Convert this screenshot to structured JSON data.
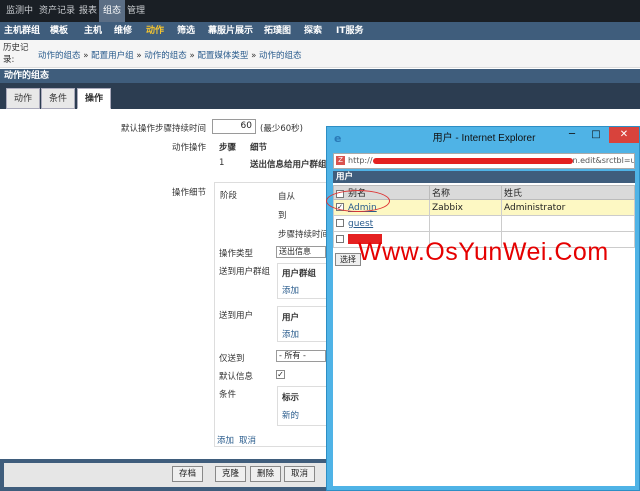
{
  "topnav": [
    "监测中",
    "资产记录",
    "报表",
    "组态",
    "管理"
  ],
  "subnav": [
    "主机群组",
    "模板",
    "主机",
    "维修",
    "动作",
    "筛选",
    "幕服片展示",
    "拓璞图",
    "探索",
    "IT服务"
  ],
  "history": {
    "label": "历史记录:",
    "crumbs": [
      "动作的组态",
      "配置用户组",
      "动作的组态",
      "配置媒体类型",
      "动作的组态"
    ],
    "sep": "»"
  },
  "section_title": "动作的组态",
  "tabs": [
    "动作",
    "条件",
    "操作"
  ],
  "form": {
    "default_step_label": "默认操作步骤持续时间",
    "default_step_value": "60",
    "default_step_hint": "(最少60秒)",
    "ops_label": "动作操作",
    "ops_col_step": "步骤",
    "ops_col_detail": "细节",
    "ops_row_step": "1",
    "ops_row_detail": "送出信息给用户群组",
    "op_detail_label": "操作细节",
    "stage_label": "阶段",
    "from_label": "自从",
    "to_label": "到",
    "step_duration_label": "步骤持续时间",
    "op_type_label": "操作类型",
    "op_type_value": "送出信息",
    "send_group_label": "送到用户群组",
    "user_group_header": "用户群组",
    "add_1": "添加",
    "send_user_label": "送到用户",
    "user_header": "用户",
    "add_2": "添加",
    "only_send_label": "仅送到",
    "only_send_value": "- 所有 -",
    "default_msg_label": "默认信息",
    "condition_label": "条件",
    "cond_header": "标示",
    "cond_new": "新的",
    "add_3": "添加",
    "cancel_link": "取消"
  },
  "footer_buttons": [
    "存档",
    "克隆",
    "删除",
    "取消"
  ],
  "popup": {
    "title": "用户 - Internet Explorer",
    "address_start": "http://",
    "address_end": "n.edit&srctbl=use",
    "section": "用户",
    "columns": [
      "别名",
      "名称",
      "姓氏"
    ],
    "rows": [
      {
        "alias": "Admin",
        "name": "Zabbix",
        "surname": "Administrator",
        "checked": true
      },
      {
        "alias": "guest",
        "name": "",
        "surname": "",
        "checked": false
      },
      {
        "alias": "",
        "name": "",
        "surname": "",
        "checked": false
      }
    ],
    "select_button": "选择",
    "window_buttons": {
      "minimize": "─",
      "maximize": "□",
      "close": "✕"
    }
  },
  "watermark": "Www.OsYunWei.Com",
  "colors": {
    "nav_blue": "#3f5d7c",
    "dark": "#1a1f25",
    "highlight": "#fdf8c3",
    "ie_frame": "#4fb3e6",
    "red": "#e50000"
  }
}
